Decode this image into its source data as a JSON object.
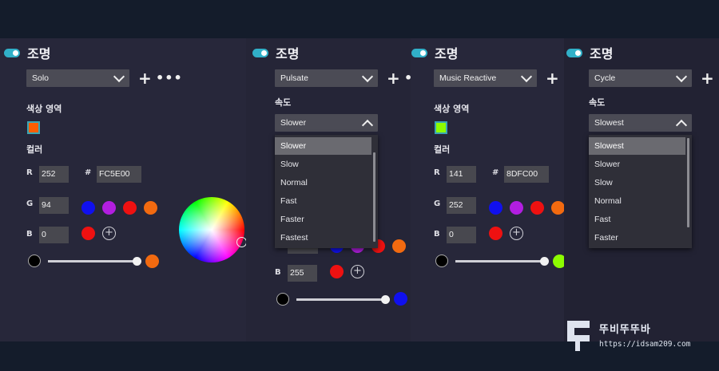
{
  "panel1": {
    "title": "조명",
    "mode": "Solo",
    "section": "색상 영역",
    "swatch_color": "#FC5E00",
    "color_label": "컬러",
    "r_label": "R",
    "r_value": "252",
    "g_label": "G",
    "g_value": "94",
    "b_label": "B",
    "b_value": "0",
    "hash": "#",
    "hex_value": "FC5E00",
    "preset_colors": [
      "#1010ee",
      "#b21ee0",
      "#ee1111",
      "#f26a10"
    ],
    "custom_colors": [
      "#ee1111"
    ],
    "end_color": "#f26a10",
    "more": "•••"
  },
  "panel2": {
    "title": "조명",
    "mode": "Pulsate",
    "section": "속도",
    "speed": "Slower",
    "speed_options": [
      "Slower",
      "Slow",
      "Normal",
      "Fast",
      "Faster",
      "Fastest"
    ],
    "b_label": "B",
    "b_value": "255",
    "preset_colors": [
      "#1010ee",
      "#b21ee0",
      "#ee1111",
      "#f26a10"
    ],
    "custom_colors": [
      "#ee1111"
    ],
    "end_color": "#1010ee"
  },
  "panel3": {
    "title": "조명",
    "mode": "Music Reactive",
    "section": "색상 영역",
    "swatch_color": "#8DFC00",
    "color_label": "컬러",
    "r_label": "R",
    "r_value": "141",
    "g_label": "G",
    "g_value": "252",
    "b_label": "B",
    "b_value": "0",
    "hash": "#",
    "hex_value": "8DFC00",
    "preset_colors": [
      "#1010ee",
      "#b21ee0",
      "#ee1111",
      "#f26a10"
    ],
    "custom_colors": [
      "#ee1111"
    ],
    "end_color": "#8DFC00"
  },
  "panel4": {
    "title": "조명",
    "mode": "Cycle",
    "section": "속도",
    "speed": "Slowest",
    "speed_options": [
      "Slowest",
      "Slower",
      "Slow",
      "Normal",
      "Fast",
      "Faster"
    ]
  },
  "watermark": {
    "text": "뚜비뚜뚜바",
    "url": "https://idsam209.com"
  },
  "colors": {
    "accent": "#31b0c8",
    "panel": "#27273a",
    "frame": "#141c2b"
  }
}
